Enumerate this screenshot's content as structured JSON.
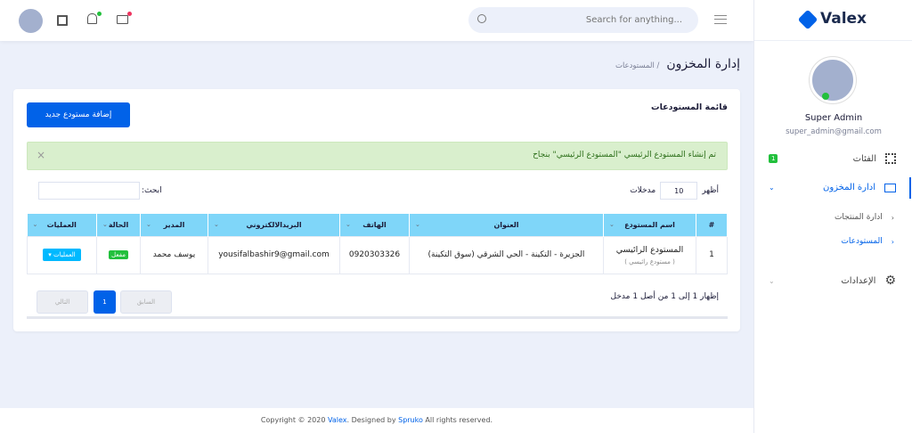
{
  "header": {
    "search_placeholder": "Search for anything..."
  },
  "brand": {
    "name": "Valex",
    "color": "#0162e8"
  },
  "user": {
    "name": "Super Admin",
    "email": "super_admin@gmail.com"
  },
  "sidebar": {
    "items": [
      {
        "label": "الفئات",
        "badge": "1"
      },
      {
        "label": "ادارة المخزون"
      },
      {
        "label": "ادارة المنتجات"
      },
      {
        "label": "المستودعات"
      },
      {
        "label": "الإعدادات"
      }
    ]
  },
  "page": {
    "title": "إدارة المخزون",
    "breadcrumb": "/ المستودعات"
  },
  "card": {
    "title": "قائمة المستودعات",
    "add_button": "إضافة مستودع جديد",
    "alert": "تم إنشاء المستودع الرئيسي \"المستودع الرئيسي\" بنجاح",
    "alert_close": "×",
    "show_label": "أظهر",
    "entries_value": "10",
    "entries_label": "مدخلات",
    "search_label": "ابحث:"
  },
  "table": {
    "headers": [
      "#",
      "اسم المستودع",
      "العنوان",
      "الهاتف",
      "البريدالالكتروني",
      "المدير",
      "الحالة",
      "العمليات"
    ],
    "rows": [
      {
        "num": "1",
        "name": "المستودع الرائيسي",
        "sub": "( مستودع رائيسي )",
        "address": "الجزيرة - التكينة - الحي الشرقي (سوق التكينة)",
        "phone": "0920303326",
        "email": "yousifalbashir9@gmail.com",
        "manager": "يوسف محمد",
        "status": "مفعل",
        "actions": "العمليات ▾"
      }
    ]
  },
  "pagination": {
    "info": "إظهار 1 إلى 1 من أصل 1 مدخل",
    "prev": "السابق",
    "page": "1",
    "next": "التالي"
  },
  "footer": {
    "copyright": "Copyright © 2020",
    "brand": "Valex",
    ". Designed by": "",
    "designed_by": ". Designed by",
    "designer": "Spruko",
    "rights": "All rights reserved."
  }
}
